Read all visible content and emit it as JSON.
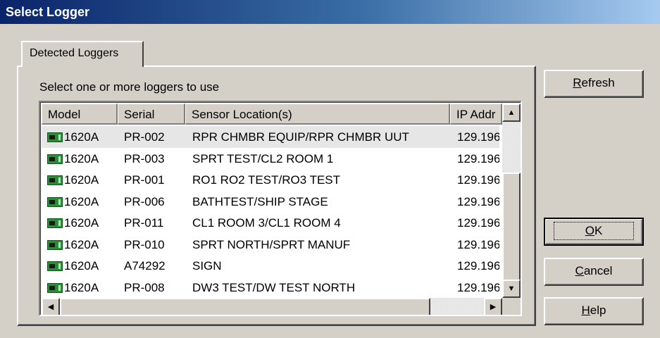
{
  "window": {
    "title": "Select Logger"
  },
  "tab": {
    "label": "Detected Loggers"
  },
  "instruction": "Select one or more loggers to use",
  "columns": [
    "Model",
    "Serial",
    "Sensor Location(s)",
    "IP Addr"
  ],
  "rows": [
    {
      "model": "1620A",
      "serial": "PR-002",
      "location": "RPR CHMBR EQUIP/RPR CHMBR UUT",
      "ip": "129.196"
    },
    {
      "model": "1620A",
      "serial": "PR-003",
      "location": "SPRT TEST/CL2 ROOM 1",
      "ip": "129.196"
    },
    {
      "model": "1620A",
      "serial": "PR-001",
      "location": "RO1 RO2 TEST/RO3 TEST",
      "ip": "129.196"
    },
    {
      "model": "1620A",
      "serial": "PR-006",
      "location": "BATHTEST/SHIP STAGE",
      "ip": "129.196"
    },
    {
      "model": "1620A",
      "serial": "PR-011",
      "location": "CL1 ROOM 3/CL1 ROOM 4",
      "ip": "129.196"
    },
    {
      "model": "1620A",
      "serial": "PR-010",
      "location": "SPRT NORTH/SPRT MANUF",
      "ip": "129.196"
    },
    {
      "model": "1620A",
      "serial": "A74292",
      "location": "SIGN",
      "ip": "129.196"
    },
    {
      "model": "1620A",
      "serial": "PR-008",
      "location": "DW3 TEST/DW TEST NORTH",
      "ip": "129.196"
    }
  ],
  "buttons": {
    "refresh": {
      "mnemonic": "R",
      "rest": "efresh"
    },
    "ok": {
      "mnemonic": "O",
      "rest": "K"
    },
    "cancel": {
      "mnemonic": "C",
      "rest": "ancel"
    },
    "help": {
      "mnemonic": "H",
      "rest": "elp"
    }
  },
  "icons": {
    "row_icon": "logger-device-icon"
  }
}
